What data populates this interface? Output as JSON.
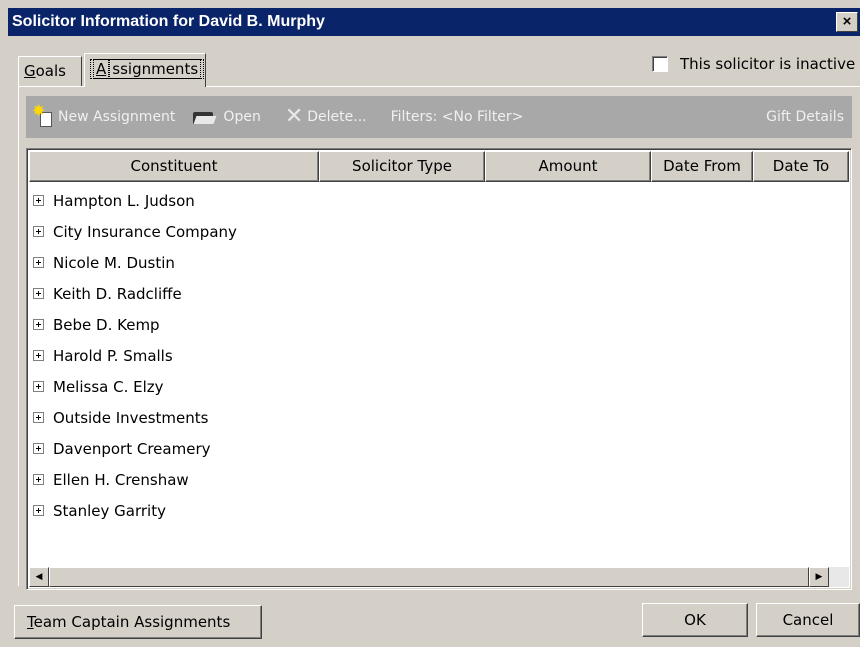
{
  "window": {
    "title": "Solicitor Information for David B. Murphy",
    "close_label": "×"
  },
  "tabs": [
    {
      "label": "Goals",
      "accel": "G",
      "rest": "oals"
    },
    {
      "label": "Assignments",
      "accel": "A",
      "rest": "ssignments",
      "selected": true
    }
  ],
  "inactive_checkbox": {
    "label": "This solicitor is inactive",
    "checked": false
  },
  "toolbar": {
    "new_label": "New Assignment",
    "open_label": "Open",
    "delete_label": "Delete...",
    "filters_label": "Filters: <No Filter>",
    "gift_details_label": "Gift Details"
  },
  "columns": [
    "Constituent",
    "Solicitor Type",
    "Amount",
    "Date From",
    "Date To"
  ],
  "rows": [
    "Hampton L. Judson",
    "City Insurance Company",
    "Nicole M. Dustin",
    "Keith D. Radcliffe",
    "Bebe D. Kemp",
    "Harold P. Smalls",
    "Melissa C. Elzy",
    "Outside Investments",
    "Davenport Creamery",
    "Ellen H. Crenshaw",
    "Stanley Garrity"
  ],
  "buttons": {
    "team_captain": {
      "label": "Team Captain Assignments",
      "accel": "T",
      "rest": "eam Captain Assignments"
    },
    "ok": "OK",
    "cancel": "Cancel"
  }
}
